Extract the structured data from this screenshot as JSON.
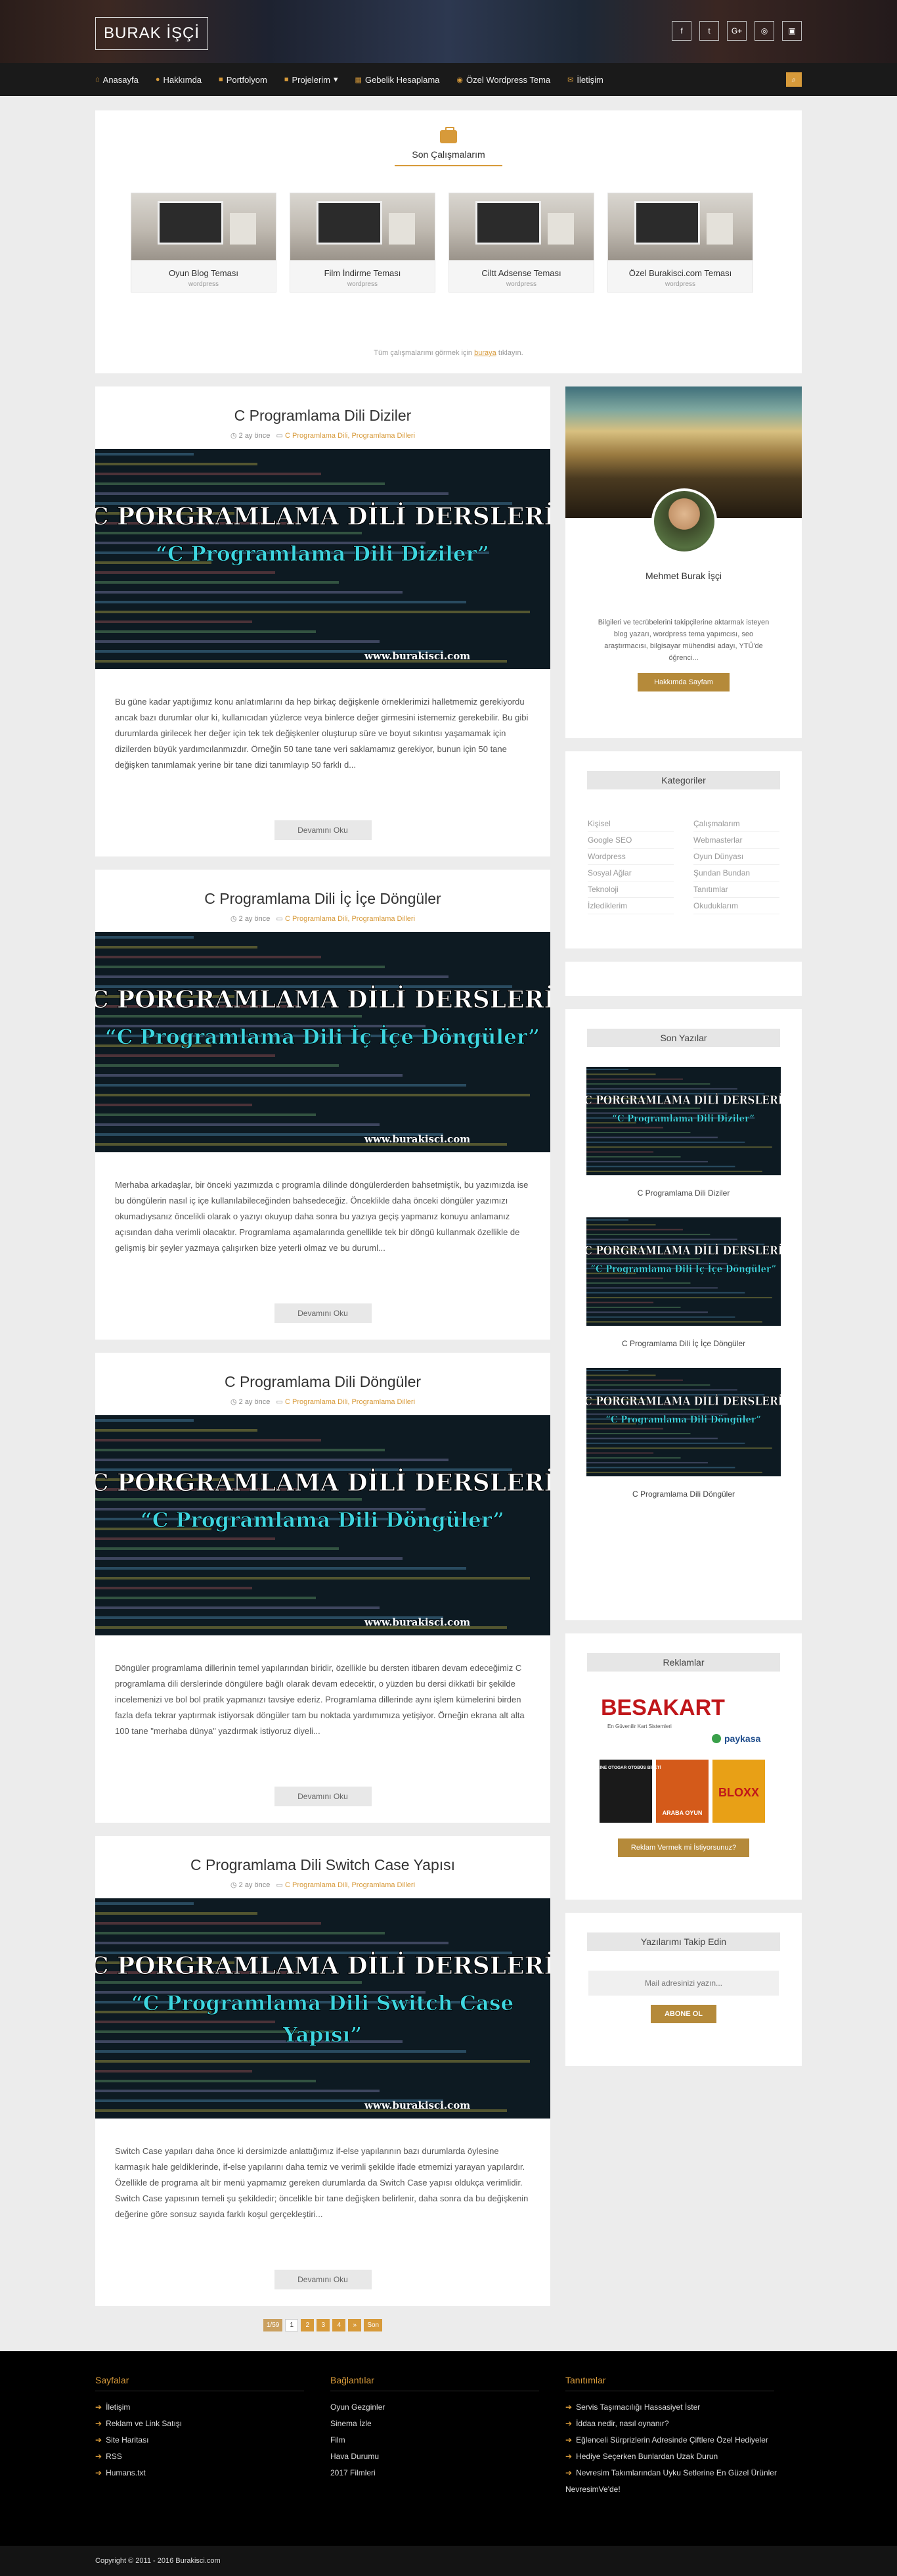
{
  "site": {
    "logo": "BURAK İŞÇİ"
  },
  "social": [
    "f",
    "t",
    "G+",
    "◎",
    "▣"
  ],
  "nav": {
    "items": [
      "Anasayfa",
      "Hakkımda",
      "Portfolyom",
      "Projelerim",
      "Gebelik Hesaplama",
      "Özel Wordpress Tema",
      "İletişim"
    ],
    "dropdown_caret": "▾"
  },
  "featured": {
    "title": "Son Çalışmalarım",
    "works": [
      {
        "title": "Oyun Blog Teması",
        "category": "wordpress"
      },
      {
        "title": "Film İndirme Teması",
        "category": "wordpress"
      },
      {
        "title": "Ciltt Adsense Teması",
        "category": "wordpress"
      },
      {
        "title": "Özel Burakisci.com Teması",
        "category": "wordpress"
      }
    ],
    "note_prefix": "Tüm çalışmalarımı görmek için",
    "note_link": "buraya",
    "note_suffix": "tıklayın."
  },
  "posts": [
    {
      "title": "C Programlama Dili Diziler",
      "date": "2 ay önce",
      "categories": "C Programlama Dili, Programlama Dilleri",
      "image_line1": "C PORGRAMLAMA DİLİ DERSLERİ",
      "image_line2": "“C Programlama Dili Diziler”",
      "image_line3": "",
      "image_url": "www.burakisci.com",
      "excerpt": "Bu güne kadar yaptığımız konu anlatımlarını da hep birkaç değişkenle örneklerimizi halletmemiz gerekiyordu ancak bazı durumlar olur ki, kullanıcıdan yüzlerce veya binlerce değer girmesini istememiz gerekebilir. Bu gibi durumlarda girilecek her değer için tek tek değişkenler oluşturup süre ve boyut sıkıntısı yaşamamak için dizilerden büyük yardımcılanmızdır. Örneğin 50 tane tane veri saklamamız gerekiyor, bunun için 50 tane değişken tanımlamak yerine bir tane dizi tanımlayıp 50 farklı d...",
      "readmore": "Devamını Oku"
    },
    {
      "title": "C Programlama Dili İç İçe Döngüler",
      "date": "2 ay önce",
      "categories": "C Programlama Dili, Programlama Dilleri",
      "image_line1": "C PORGRAMLAMA DİLİ DERSLERİ",
      "image_line2": "“C Programlama Dili İç İçe Döngüler”",
      "image_line3": "",
      "image_url": "www.burakisci.com",
      "excerpt": "Merhaba arkadaşlar, bir önceki yazımızda c programla dilinde döngülerderden bahsetmiştik, bu yazımızda ise bu döngülerin nasıl iç içe kullanılabileceğinden bahsedeceğiz. Önceklikle daha önceki döngüler yazımızı okumadıysanız öncelikli olarak o yazıyı okuyup daha sonra bu yazıya geçiş yapmanız konuyu anlamanız açısından daha verimli olacaktır. Programlama aşamalarında genellikle tek bir döngü kullanmak özellikle de gelişmiş bir şeyler yazmaya çalışırken bize yeterli olmaz ve bu duruml...",
      "readmore": "Devamını Oku"
    },
    {
      "title": "C Programlama Dili Döngüler",
      "date": "2 ay önce",
      "categories": "C Programlama Dili, Programlama Dilleri",
      "image_line1": "C PORGRAMLAMA DİLİ DERSLERİ",
      "image_line2": "“C Programlama Dili Döngüler”",
      "image_line3": "",
      "image_url": "www.burakisci.com",
      "excerpt": "Döngüler programlama dillerinin temel yapılarından biridir, özellikle bu dersten itibaren devam edeceğimiz C programlama dili derslerinde döngülere bağlı olarak devam edecektir, o yüzden bu dersi dikkatli bir şekilde incelemenizi ve bol bol pratik yapmanızı tavsiye ederiz. Programlama dillerinde aynı işlem kümelerini birden fazla defa tekrar yaptırmak istiyorsak döngüler tam bu noktada yardımımıza yetişiyor. Örneğin ekrana alt alta 100 tane \"merhaba dünya\" yazdırmak istiyoruz diyeli...",
      "readmore": "Devamını Oku"
    },
    {
      "title": "C Programlama Dili Switch Case Yapısı",
      "date": "2 ay önce",
      "categories": "C Programlama Dili, Programlama Dilleri",
      "image_line1": "C PORGRAMLAMA DİLİ DERSLERİ",
      "image_line2": "“C Programlama Dili Switch Case",
      "image_line3": "Yapısı”",
      "image_url": "www.burakisci.com",
      "excerpt": "Switch Case yapıları daha önce ki dersimizde anlattığımız if-else yapılarının bazı durumlarda öylesine karmaşık hale geldiklerinde, if-else yapılarını daha temiz ve verimli şekilde ifade etmemizi yarayan yapılardır. Özellikle de programa alt bir menü yapmamız gereken durumlarda da Switch Case yapısı oldukça verimlidir. Switch Case yapısının temeli şu şekildedir; öncelikle bir tane değişken belirlenir, daha sonra da bu değişkenin değerine göre sonsuz sayıda farklı koşul gerçekleştiri...",
      "readmore": "Devamını Oku"
    }
  ],
  "pagination": {
    "label": "1/59",
    "pages": [
      "1",
      "2",
      "3",
      "4",
      "»",
      "Son"
    ]
  },
  "profile": {
    "name": "Mehmet Burak İşçi",
    "bio": "Bilgileri ve tecrübelerini takipçilerine aktarmak isteyen blog yazarı, wordpress tema yapımcısı, seo araştırmacısı, bilgisayar mühendisi adayı, YTÜ'de öğrenci...",
    "button": "Hakkımda Sayfam"
  },
  "categories_widget": {
    "title": "Kategoriler",
    "items": [
      "Kişisel",
      "Çalışmalarım",
      "Google SEO",
      "Webmasterlar",
      "Wordpress",
      "Oyun Dünyası",
      "Sosyal Ağlar",
      "Şundan Bundan",
      "Teknoloji",
      "Tanıtımlar",
      "İzlediklerim",
      "Okuduklarım"
    ]
  },
  "recent_widget": {
    "title": "Son Yazılar",
    "items": [
      {
        "title": "C Programlama Dili Diziler",
        "line2": "“C Programlama Dili Diziler”",
        "line3": ""
      },
      {
        "title": "C Programlama Dili İç İçe Döngüler",
        "line2": "“C Programlama Dili İç İçe Döngüler”",
        "line3": ""
      },
      {
        "title": "C Programlama Dili Döngüler",
        "line2": "“C Programlama Dili Döngüler”",
        "line3": ""
      }
    ]
  },
  "ads_widget": {
    "title": "Reklamlar",
    "brand": "BESAKART",
    "brand_tagline": "En Güvenilir Kart Sistemleri",
    "payment": "paykasa",
    "games": [
      "ONLINE OTOGAR OTOBÜS BİLETİ",
      "ARABA OYUN",
      "BLOXX"
    ],
    "button": "Reklam Vermek mi İstiyorsunuz?"
  },
  "follow_widget": {
    "title": "Yazılarımı Takip Edin",
    "placeholder": "Mail adresinizi yazın...",
    "button": "ABONE OL"
  },
  "footer": {
    "cols": [
      {
        "title": "Sayfalar",
        "items": [
          "İletişim",
          "Reklam ve Link Satışı",
          "Site Haritası",
          "RSS",
          "Humans.txt"
        ]
      },
      {
        "title": "Bağlantılar",
        "items": [
          "Oyun Gezginler",
          "Sinema İzle",
          "Film",
          "Hava Durumu",
          "2017 Filmleri"
        ]
      },
      {
        "title": "Tanıtımlar",
        "items": [
          "Servis Taşımacılığı Hassasiyet İster",
          "İddaa nedir, nasıl oynanır?",
          "Eğlenceli Sürprizlerin Adresinde Çiftlere Özel Hediyeler",
          "Hediye Seçerken Bunlardan Uzak Durun",
          "Nevresim Takımlarından Uyku Setlerine En Güzel Ürünler NevresimVe'de!"
        ]
      }
    ],
    "copyright": "Copyright © 2011 - 2016 Burakisci.com"
  },
  "colors": {
    "accent": "#d79a3a",
    "image_bg": "#0d1a22",
    "image_title": "#ffffff",
    "image_subtitle": "#3ed6e0",
    "footer_bg": "#000000"
  }
}
